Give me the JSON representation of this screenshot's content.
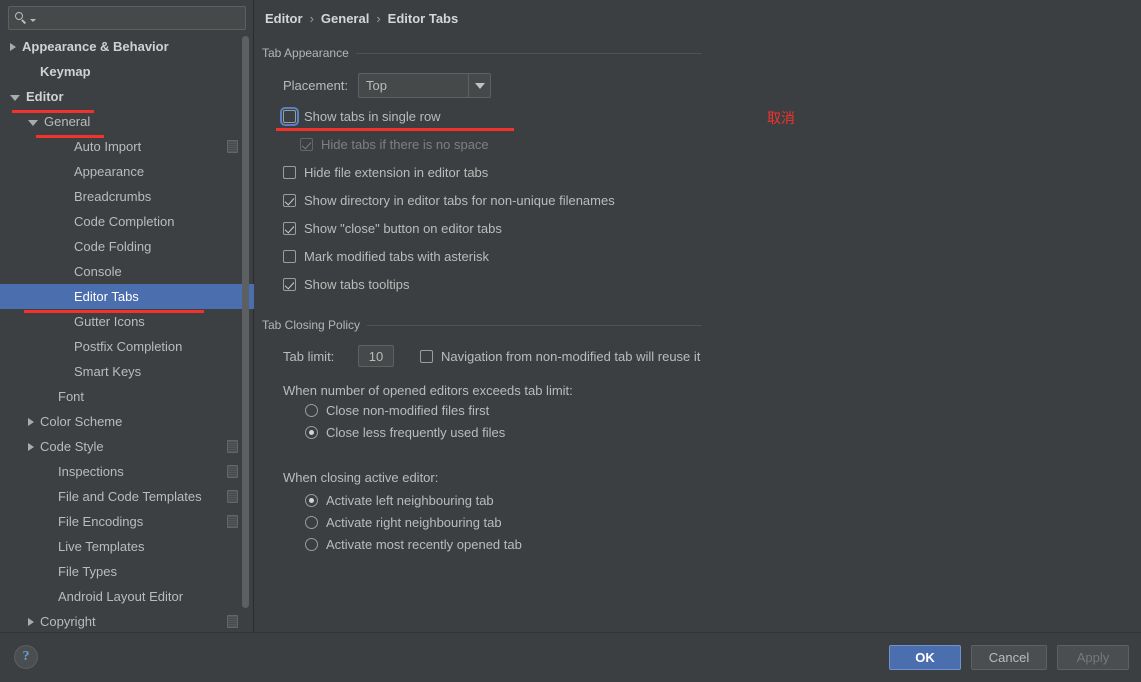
{
  "search": {
    "value": "",
    "placeholder": "",
    "icon": "search-icon"
  },
  "sidebar": {
    "items": [
      {
        "label": "Appearance & Behavior",
        "arrow": "right",
        "indent": 0,
        "bold": true,
        "selected": false,
        "cfg": false
      },
      {
        "label": "Keymap",
        "arrow": "none",
        "indent": 1,
        "bold": true,
        "selected": false,
        "cfg": false
      },
      {
        "label": "Editor",
        "arrow": "down",
        "indent": 0,
        "bold": true,
        "selected": false,
        "cfg": false
      },
      {
        "label": "General",
        "arrow": "down",
        "indent": 1,
        "bold": false,
        "selected": false,
        "cfg": false
      },
      {
        "label": "Auto Import",
        "arrow": "none",
        "indent": 3,
        "bold": false,
        "selected": false,
        "cfg": true
      },
      {
        "label": "Appearance",
        "arrow": "none",
        "indent": 3,
        "bold": false,
        "selected": false,
        "cfg": false
      },
      {
        "label": "Breadcrumbs",
        "arrow": "none",
        "indent": 3,
        "bold": false,
        "selected": false,
        "cfg": false
      },
      {
        "label": "Code Completion",
        "arrow": "none",
        "indent": 3,
        "bold": false,
        "selected": false,
        "cfg": false
      },
      {
        "label": "Code Folding",
        "arrow": "none",
        "indent": 3,
        "bold": false,
        "selected": false,
        "cfg": false
      },
      {
        "label": "Console",
        "arrow": "none",
        "indent": 3,
        "bold": false,
        "selected": false,
        "cfg": false
      },
      {
        "label": "Editor Tabs",
        "arrow": "none",
        "indent": 3,
        "bold": false,
        "selected": true,
        "cfg": false
      },
      {
        "label": "Gutter Icons",
        "arrow": "none",
        "indent": 3,
        "bold": false,
        "selected": false,
        "cfg": false
      },
      {
        "label": "Postfix Completion",
        "arrow": "none",
        "indent": 3,
        "bold": false,
        "selected": false,
        "cfg": false
      },
      {
        "label": "Smart Keys",
        "arrow": "none",
        "indent": 3,
        "bold": false,
        "selected": false,
        "cfg": false
      },
      {
        "label": "Font",
        "arrow": "none",
        "indent": 2,
        "bold": false,
        "selected": false,
        "cfg": false
      },
      {
        "label": "Color Scheme",
        "arrow": "right",
        "indent": 1,
        "bold": false,
        "selected": false,
        "cfg": false
      },
      {
        "label": "Code Style",
        "arrow": "right",
        "indent": 1,
        "bold": false,
        "selected": false,
        "cfg": true
      },
      {
        "label": "Inspections",
        "arrow": "none",
        "indent": 2,
        "bold": false,
        "selected": false,
        "cfg": true
      },
      {
        "label": "File and Code Templates",
        "arrow": "none",
        "indent": 2,
        "bold": false,
        "selected": false,
        "cfg": true
      },
      {
        "label": "File Encodings",
        "arrow": "none",
        "indent": 2,
        "bold": false,
        "selected": false,
        "cfg": true
      },
      {
        "label": "Live Templates",
        "arrow": "none",
        "indent": 2,
        "bold": false,
        "selected": false,
        "cfg": false
      },
      {
        "label": "File Types",
        "arrow": "none",
        "indent": 2,
        "bold": false,
        "selected": false,
        "cfg": false
      },
      {
        "label": "Android Layout Editor",
        "arrow": "none",
        "indent": 2,
        "bold": false,
        "selected": false,
        "cfg": false
      },
      {
        "label": "Copyright",
        "arrow": "right",
        "indent": 1,
        "bold": false,
        "selected": false,
        "cfg": true
      }
    ]
  },
  "breadcrumb": {
    "root": "Editor",
    "sep1": "›",
    "mid": "General",
    "sep2": "›",
    "leaf": "Editor Tabs"
  },
  "tab_appearance": {
    "title": "Tab Appearance",
    "placement_label": "Placement:",
    "placement_value": "Top",
    "checkboxes": [
      {
        "label": "Show tabs in single row",
        "checked": false,
        "disabled": false,
        "focused": true
      },
      {
        "label": "Hide tabs if there is no space",
        "checked": true,
        "disabled": true,
        "focused": false
      },
      {
        "label": "Hide file extension in editor tabs",
        "checked": false,
        "disabled": false,
        "focused": false
      },
      {
        "label": "Show directory in editor tabs for non-unique filenames",
        "checked": true,
        "disabled": false,
        "focused": false
      },
      {
        "label": "Show \"close\" button on editor tabs",
        "checked": true,
        "disabled": false,
        "focused": false
      },
      {
        "label": "Mark modified tabs with asterisk",
        "checked": false,
        "disabled": false,
        "focused": false
      },
      {
        "label": "Show tabs tooltips",
        "checked": true,
        "disabled": false,
        "focused": false
      }
    ]
  },
  "tab_closing": {
    "title": "Tab Closing Policy",
    "tab_limit_label": "Tab limit:",
    "tab_limit_value": "10",
    "reuse_checkbox": {
      "label": "Navigation from non-modified tab will reuse it",
      "checked": false
    },
    "exceed_label": "When number of opened editors exceeds tab limit:",
    "exceed_options": [
      {
        "label": "Close non-modified files first",
        "selected": false
      },
      {
        "label": "Close less frequently used files",
        "selected": true
      }
    ],
    "closing_label": "When closing active editor:",
    "closing_options": [
      {
        "label": "Activate left neighbouring tab",
        "selected": true
      },
      {
        "label": "Activate right neighbouring tab",
        "selected": false
      },
      {
        "label": "Activate most recently opened tab",
        "selected": false
      }
    ]
  },
  "annotation": {
    "text": "取消",
    "color": "#f4322c"
  },
  "footer": {
    "help": "?",
    "ok": "OK",
    "cancel": "Cancel",
    "apply": "Apply"
  },
  "colors": {
    "background": "#3c3f41",
    "sidebar": "#3c4043",
    "selection": "#4b6eaf",
    "accent_red": "#f4322c",
    "text": "#bbbbbb"
  }
}
